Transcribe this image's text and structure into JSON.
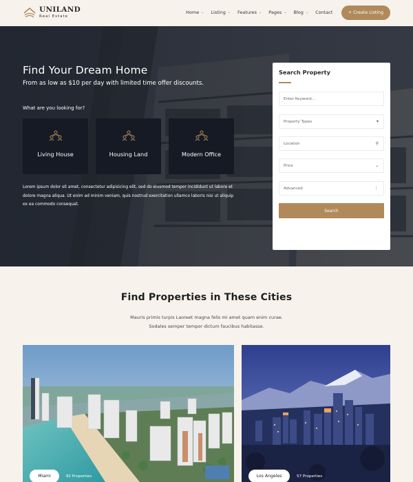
{
  "brand": {
    "name": "UNILAND",
    "tagline": "Real Estate"
  },
  "nav": {
    "items": [
      {
        "label": "Home",
        "has_dropdown": true
      },
      {
        "label": "Listing",
        "has_dropdown": true
      },
      {
        "label": "Features",
        "has_dropdown": true
      },
      {
        "label": "Pages",
        "has_dropdown": true
      },
      {
        "label": "Blog",
        "has_dropdown": true
      },
      {
        "label": "Contact",
        "has_dropdown": false
      }
    ],
    "cta_label": "+ Create Listing"
  },
  "hero": {
    "title": "Find Your Dream Home",
    "subtitle": "From as low as $10 per day with limited time offer discounts.",
    "question": "What are you looking for?",
    "categories": [
      {
        "label": "Living House",
        "icon": "people-network-icon"
      },
      {
        "label": "Housing Land",
        "icon": "people-network-icon"
      },
      {
        "label": "Modern Office",
        "icon": "people-network-icon"
      }
    ],
    "body": "Lorem ipsum dolor sit amet, consectetur adipisicing elit, sed do eiusmod tempor incididunt ut labore et dolore magna aliqua. Ut enim ad minim veniam, quis nostrud exercitation ullamco laboris nisi ut aliquip ex ea commodo consequat."
  },
  "search": {
    "title": "Search Property",
    "keyword_placeholder": "Enter Keyword...",
    "property_types": "Property Types",
    "location": "Location",
    "price": "Price",
    "advanced": "Advanced",
    "button": "Search"
  },
  "cities": {
    "title": "Find Properties in These Cities",
    "desc_line1": "Mauris primis turpis Laoreet magna felis mi amet quam enim curae.",
    "desc_line2": "Sodales semper tempor dictum faucibus habitasse.",
    "items": [
      {
        "name": "Miami",
        "count": "82 Properties"
      },
      {
        "name": "Los Angeles",
        "count": "57 Properties"
      }
    ]
  },
  "colors": {
    "accent": "#b08a5a",
    "background": "#f7f3ec",
    "card": "#151a24"
  }
}
